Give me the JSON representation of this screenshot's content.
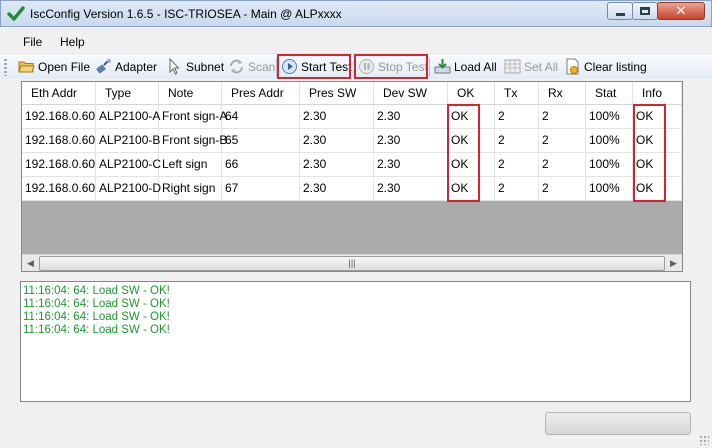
{
  "window": {
    "title": "IscConfig Version 1.6.5 - ISC-TRIOSEA - Main @ ALPxxxx"
  },
  "menu": {
    "items": [
      {
        "label": "File"
      },
      {
        "label": "Help"
      }
    ]
  },
  "toolbar": {
    "open_file": "Open File",
    "adapter": "Adapter",
    "subnet": "Subnet",
    "scan": "Scan",
    "start_test": "Start Test",
    "stop_test": "Stop Test",
    "load_all": "Load All",
    "set_all": "Set All",
    "clear_listing": "Clear listing"
  },
  "grid": {
    "columns": [
      "Eth Addr",
      "Type",
      "Note",
      "Pres Addr",
      "Pres SW",
      "Dev SW",
      "OK",
      "Tx",
      "Rx",
      "Stat",
      "Info"
    ],
    "rows": [
      [
        "192.168.0.60",
        "ALP2100-A",
        "Front sign-A",
        "64",
        "2.30",
        "2.30",
        "OK",
        "2",
        "2",
        "100%",
        "OK"
      ],
      [
        "192.168.0.60",
        "ALP2100-B",
        "Front sign-B",
        "65",
        "2.30",
        "2.30",
        "OK",
        "2",
        "2",
        "100%",
        "OK"
      ],
      [
        "192.168.0.60",
        "ALP2100-C",
        "Left sign",
        "66",
        "2.30",
        "2.30",
        "OK",
        "2",
        "2",
        "100%",
        "OK"
      ],
      [
        "192.168.0.60",
        "ALP2100-D",
        "Right sign",
        "67",
        "2.30",
        "2.30",
        "OK",
        "2",
        "2",
        "100%",
        "OK"
      ]
    ]
  },
  "log": {
    "lines": [
      "11:16:04: 64: Load SW - OK!",
      "11:16:04: 64: Load SW - OK!",
      "11:16:04: 64: Load SW - OK!",
      "11:16:04: 64: Load SW - OK!"
    ],
    "color": "#1a9a2a"
  },
  "progress": {
    "value": 0
  },
  "colors": {
    "highlight": "#d3242f",
    "disabled_text": "#9a9a9a"
  }
}
